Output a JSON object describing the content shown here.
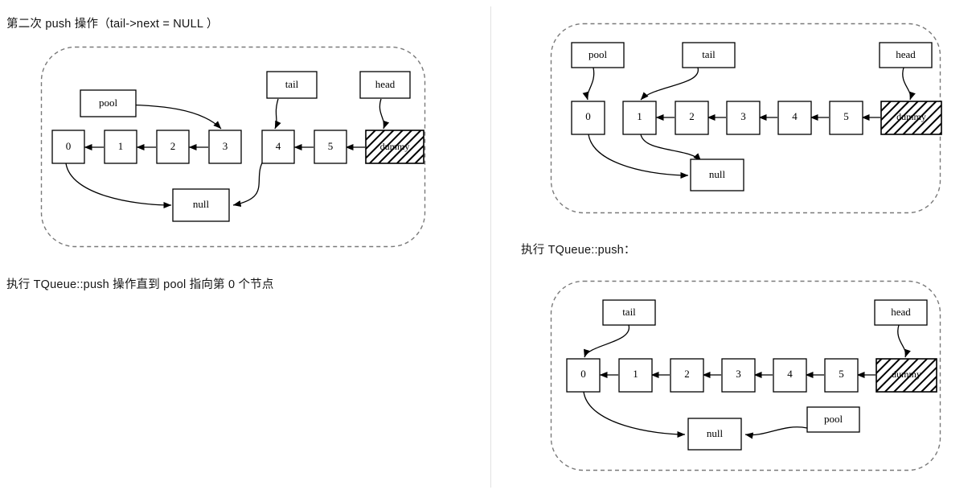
{
  "captions": {
    "left_title": "第二次 push 操作（tail->next = NULL ）",
    "left_bottom": "执行 TQueue::push 操作直到 pool 指向第 0 个节点",
    "right_middle": "执行 TQueue::push："
  },
  "labels": {
    "pool": "pool",
    "tail": "tail",
    "head": "head",
    "null": "null",
    "dummy": "dummy"
  },
  "colors": {
    "stroke": "#000000",
    "container_border": "#7a7a7a",
    "divider": "#e2e2e2",
    "background": "#ffffff"
  },
  "diagrams": [
    {
      "id": "left-diagram",
      "name": "second-push-state",
      "nodes": [
        "0",
        "1",
        "2",
        "3",
        "4",
        "5"
      ],
      "dummy": "dummy",
      "null_box": "null",
      "pointers": [
        {
          "from": "pool",
          "to": "3"
        },
        {
          "from": "tail",
          "to": "4"
        },
        {
          "from": "head",
          "to": "dummy"
        }
      ],
      "chain_links": [
        "1->0",
        "2->1",
        "3->2",
        "5->4",
        "dummy->5"
      ],
      "null_links": [
        "0->null",
        "4->null"
      ]
    },
    {
      "id": "top-right-diagram",
      "name": "pool-at-node-0-state",
      "nodes": [
        "0",
        "1",
        "2",
        "3",
        "4",
        "5"
      ],
      "dummy": "dummy",
      "null_box": "null",
      "pointers": [
        {
          "from": "pool",
          "to": "0"
        },
        {
          "from": "tail",
          "to": "1"
        },
        {
          "from": "head",
          "to": "dummy"
        }
      ],
      "chain_links": [
        "2->1",
        "3->2",
        "4->3",
        "5->4",
        "dummy->5"
      ],
      "null_links": [
        "0->null",
        "1->null"
      ]
    },
    {
      "id": "bottom-right-diagram",
      "name": "after-push-state",
      "nodes": [
        "0",
        "1",
        "2",
        "3",
        "4",
        "5"
      ],
      "dummy": "dummy",
      "null_box": "null",
      "pointers": [
        {
          "from": "tail",
          "to": "0"
        },
        {
          "from": "head",
          "to": "dummy"
        },
        {
          "from": "pool",
          "to": "null"
        }
      ],
      "chain_links": [
        "1->0",
        "2->1",
        "3->2",
        "4->3",
        "5->4",
        "dummy->5"
      ],
      "null_links": [
        "0->null"
      ]
    }
  ]
}
